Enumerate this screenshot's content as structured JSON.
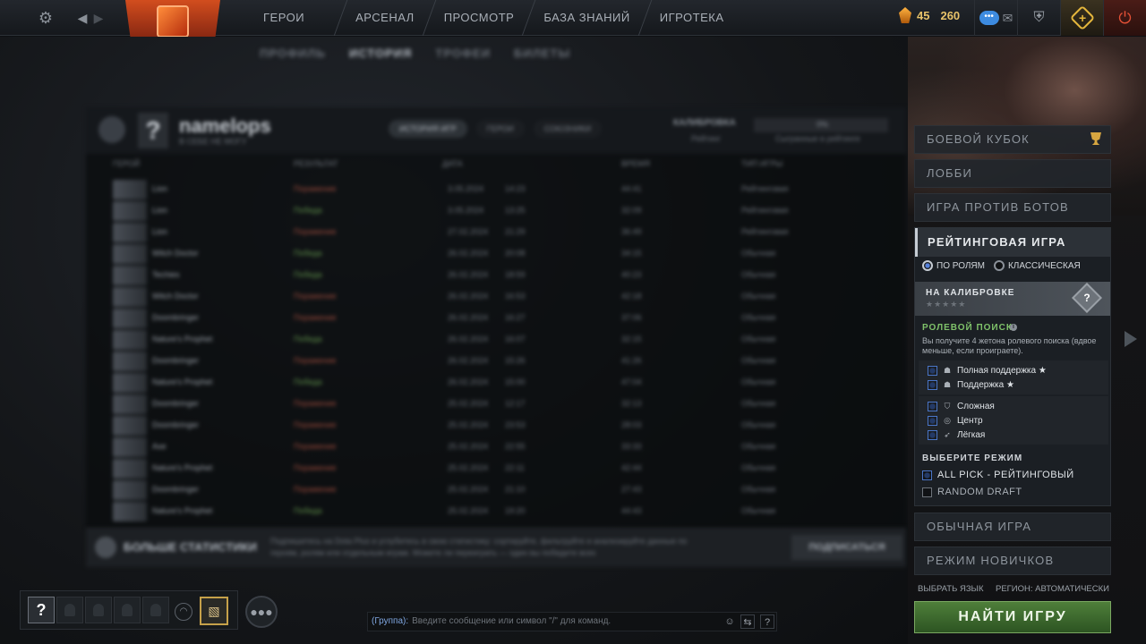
{
  "nav": {
    "items": [
      "ГЕРОИ",
      "АРСЕНАЛ",
      "ПРОСМОТР",
      "БАЗА ЗНАНИЙ",
      "ИГРОТЕКА"
    ]
  },
  "currency": {
    "shards": "45",
    "gold": "260"
  },
  "colors": {
    "accent_green": "#7fc26a",
    "find_game": "#4f7f3a",
    "power": "#e35036",
    "plus_gold": "#e4b63c"
  },
  "icons": {
    "settings": "gear-icon",
    "back": "chevron-left-icon",
    "forward": "chevron-right-icon",
    "chat": "chat-bubble-icon",
    "mail": "mail-icon",
    "armory": "shield-icon",
    "plus": "dota-plus-icon",
    "power": "power-icon"
  },
  "subtabs": [
    "ПРОФИЛЬ",
    "ИСТОРИЯ",
    "ТРОФЕИ",
    "БИЛЕТЫ"
  ],
  "profile": {
    "name": "namelops",
    "sub": "В СЕБЕ НЕ МОГУ",
    "tabs": [
      "ИСТОРИЯ ИГР",
      "ГЕРОИ",
      "СОЮЗНИКИ"
    ],
    "calibration_label": "КАЛИБРОВКА",
    "calibration_sub": "Рейтинг",
    "bar_value": "0%",
    "bar_sub": "Сыгранные в рейтинге"
  },
  "history": {
    "columns": [
      "ГЕРОЙ",
      "РЕЗУЛЬТАТ",
      "ДАТА",
      "ВРЕМЯ",
      "ТИП ИГРЫ"
    ],
    "rows": [
      {
        "hero": "Lion",
        "result": "Поражение",
        "win": false,
        "date": "3.05.2024",
        "time": "14:23",
        "duration": "44:41",
        "type": "Рейтинговая"
      },
      {
        "hero": "Lion",
        "result": "Победа",
        "win": true,
        "date": "3.05.2024",
        "time": "13:25",
        "duration": "32:09",
        "type": "Рейтинговая"
      },
      {
        "hero": "Lion",
        "result": "Поражение",
        "win": false,
        "date": "27.02.2024",
        "time": "21:29",
        "duration": "36:49",
        "type": "Рейтинговая"
      },
      {
        "hero": "Witch Doctor",
        "result": "Победа",
        "win": true,
        "date": "26.02.2024",
        "time": "20:08",
        "duration": "34:15",
        "type": "Обычная"
      },
      {
        "hero": "Techies",
        "result": "Победа",
        "win": true,
        "date": "26.02.2024",
        "time": "18:59",
        "duration": "40:23",
        "type": "Обычная"
      },
      {
        "hero": "Witch Doctor",
        "result": "Поражение",
        "win": false,
        "date": "26.02.2024",
        "time": "16:53",
        "duration": "42:18",
        "type": "Обычная"
      },
      {
        "hero": "Doombringer",
        "result": "Поражение",
        "win": false,
        "date": "26.02.2024",
        "time": "16:27",
        "duration": "37:06",
        "type": "Обычная"
      },
      {
        "hero": "Nature's Prophet",
        "result": "Победа",
        "win": true,
        "date": "26.02.2024",
        "time": "16:07",
        "duration": "32:15",
        "type": "Обычная"
      },
      {
        "hero": "Doombringer",
        "result": "Поражение",
        "win": false,
        "date": "26.02.2024",
        "time": "15:26",
        "duration": "41:26",
        "type": "Обычная"
      },
      {
        "hero": "Nature's Prophet",
        "result": "Победа",
        "win": true,
        "date": "26.02.2024",
        "time": "15:00",
        "duration": "47:04",
        "type": "Обычная"
      },
      {
        "hero": "Doombringer",
        "result": "Поражение",
        "win": false,
        "date": "25.02.2024",
        "time": "12:17",
        "duration": "32:13",
        "type": "Обычная"
      },
      {
        "hero": "Doombringer",
        "result": "Поражение",
        "win": false,
        "date": "25.02.2024",
        "time": "23:53",
        "duration": "28:03",
        "type": "Обычная"
      },
      {
        "hero": "Axe",
        "result": "Поражение",
        "win": false,
        "date": "25.02.2024",
        "time": "22:55",
        "duration": "33:33",
        "type": "Обычная"
      },
      {
        "hero": "Nature's Prophet",
        "result": "Поражение",
        "win": false,
        "date": "25.02.2024",
        "time": "22:11",
        "duration": "42:44",
        "type": "Обычная"
      },
      {
        "hero": "Doombringer",
        "result": "Поражение",
        "win": false,
        "date": "25.02.2024",
        "time": "21:10",
        "duration": "27:43",
        "type": "Обычная"
      },
      {
        "hero": "Nature's Prophet",
        "result": "Победа",
        "win": true,
        "date": "25.02.2024",
        "time": "19:20",
        "duration": "44:43",
        "type": "Обычная"
      }
    ]
  },
  "stats_banner": {
    "title": "БОЛЬШЕ СТАТИСТИКИ",
    "text": "Подпишитесь на Dota Plus и углубитесь в свою статистику: сортируйте, фильтруйте и анализируйте данные по героям, ролям или отдельным играм. Можете ли переиграть — один вы победите всех",
    "button": "ПОДПИСАТЬСЯ"
  },
  "modes": {
    "battle_cup": "БОЕВОЙ КУБОК",
    "lobby": "ЛОББИ",
    "bots": "ИГРА ПРОТИВ БОТОВ",
    "ranked": "РЕЙТИНГОВАЯ ИГРА",
    "normal": "ОБЫЧНАЯ ИГРА",
    "newbie": "РЕЖИМ НОВИЧКОВ"
  },
  "ranked": {
    "radio_roles": "ПО РОЛЯМ",
    "radio_classic": "КЛАССИЧЕСКАЯ",
    "selected_radio": "roles",
    "calibration": "НА КАЛИБРОВКЕ",
    "stars": "★★★★★",
    "medal": "?",
    "role_search_title": "РОЛЕВОЙ ПОИСК",
    "role_search_desc": "Вы получите 4 жетона ролевого поиска (вдвое меньше, если проиграете).",
    "roles": [
      {
        "label": "Полная поддержка ★",
        "icon": "☗"
      },
      {
        "label": "Поддержка ★",
        "icon": "☗"
      },
      {
        "label": "Сложная",
        "icon": "⛉"
      },
      {
        "label": "Центр",
        "icon": "◎"
      },
      {
        "label": "Лёгкая",
        "icon": "➶"
      }
    ],
    "select_mode_title": "ВЫБЕРИТЕ РЕЖИМ",
    "mode_all_pick": "ALL PICK - РЕЙТИНГОВЫЙ",
    "mode_random_draft": "RANDOM DRAFT"
  },
  "footer": {
    "language": "ВЫБРАТЬ ЯЗЫК",
    "region": "РЕГИОН: АВТОМАТИЧЕСКИ",
    "find_game": "НАЙТИ ИГРУ"
  },
  "party": {
    "self_slot": "?"
  },
  "chat": {
    "group": "(Группа):",
    "placeholder": "Введите сообщение или символ \"/\" для команд.",
    "help": "?"
  }
}
